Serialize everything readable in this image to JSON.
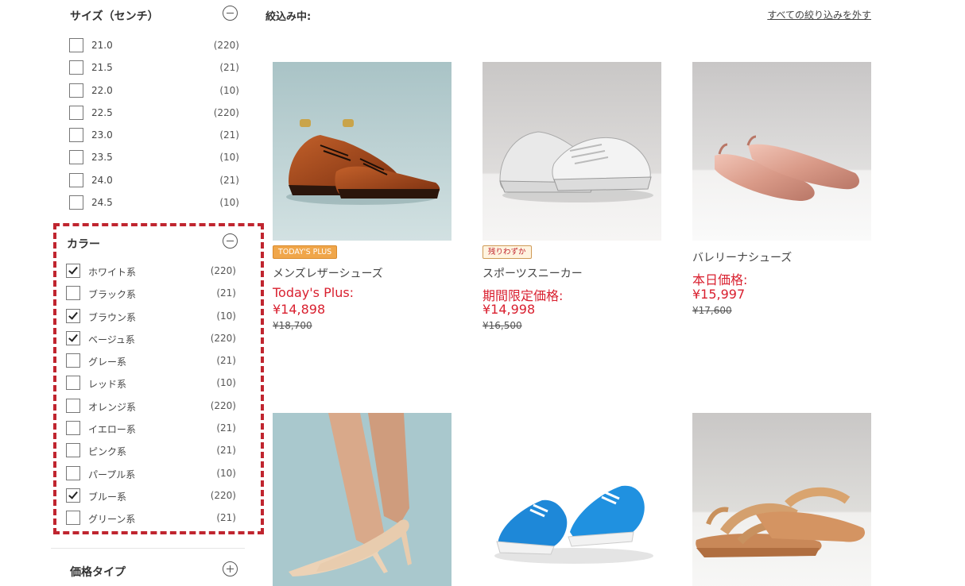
{
  "filters": {
    "size": {
      "title": "サイズ（センチ）",
      "options": [
        {
          "label": "21.0",
          "count": "(220)",
          "checked": false
        },
        {
          "label": "21.5",
          "count": "(21)",
          "checked": false
        },
        {
          "label": "22.0",
          "count": "(10)",
          "checked": false
        },
        {
          "label": "22.5",
          "count": "(220)",
          "checked": false
        },
        {
          "label": "23.0",
          "count": "(21)",
          "checked": false
        },
        {
          "label": "23.5",
          "count": "(10)",
          "checked": false
        },
        {
          "label": "24.0",
          "count": "(21)",
          "checked": false
        },
        {
          "label": "24.5",
          "count": "(10)",
          "checked": false
        }
      ]
    },
    "color": {
      "title": "カラー",
      "options": [
        {
          "label": "ホワイト系",
          "count": "(220)",
          "checked": true
        },
        {
          "label": "ブラック系",
          "count": "(21)",
          "checked": false
        },
        {
          "label": "ブラウン系",
          "count": "(10)",
          "checked": true
        },
        {
          "label": "ベージュ系",
          "count": "(220)",
          "checked": true
        },
        {
          "label": "グレー系",
          "count": "(21)",
          "checked": false
        },
        {
          "label": "レッド系",
          "count": "(10)",
          "checked": false
        },
        {
          "label": "オレンジ系",
          "count": "(220)",
          "checked": false
        },
        {
          "label": "イエロー系",
          "count": "(21)",
          "checked": false
        },
        {
          "label": "ピンク系",
          "count": "(21)",
          "checked": false
        },
        {
          "label": "パープル系",
          "count": "(10)",
          "checked": false
        },
        {
          "label": "ブルー系",
          "count": "(220)",
          "checked": true
        },
        {
          "label": "グリーン系",
          "count": "(21)",
          "checked": false
        }
      ]
    },
    "price_type": {
      "title": "価格タイプ"
    }
  },
  "main": {
    "filter_label": "絞込み中:",
    "clear_all": "すべての絞り込みを外す"
  },
  "products": [
    {
      "name": "メンズレザーシューズ",
      "badge": "TODAY'S PLUS",
      "price_label": "Today's Plus:",
      "price": "¥14,898",
      "old_price": "¥18,700"
    },
    {
      "name": "スポーツスニーカー",
      "badge": "残りわずか",
      "price_label": "期間限定価格:",
      "price": "¥14,998",
      "old_price": "¥16,500"
    },
    {
      "name": "バレリーナシューズ",
      "price_label": "本日価格:",
      "price": "¥15,997",
      "old_price": "¥17,600"
    },
    {},
    {},
    {}
  ],
  "colors": {
    "accent_red": "#d9202f",
    "highlight_border": "#c0252f",
    "badge_orange": "#f0a64a"
  }
}
